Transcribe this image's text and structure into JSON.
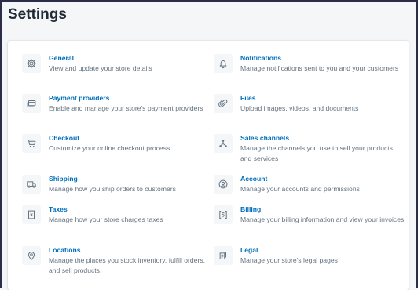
{
  "page": {
    "title": "Settings"
  },
  "settings": {
    "items": [
      {
        "icon": "gear-icon",
        "title": "General",
        "description": "View and update your store details"
      },
      {
        "icon": "bell-icon",
        "title": "Notifications",
        "description": "Manage notifications sent to you and your customers"
      },
      {
        "icon": "credit-card-icon",
        "title": "Payment providers",
        "description": "Enable and manage your store's payment providers"
      },
      {
        "icon": "paperclip-icon",
        "title": "Files",
        "description": "Upload images, videos, and documents"
      },
      {
        "icon": "cart-icon",
        "title": "Checkout",
        "description": "Customize your online checkout process"
      },
      {
        "icon": "channels-icon",
        "title": "Sales channels",
        "description": "Manage the channels you use to sell your products and services"
      },
      {
        "icon": "truck-icon",
        "title": "Shipping",
        "description": "Manage how you ship orders to customers"
      },
      {
        "icon": "account-icon",
        "title": "Account",
        "description": "Manage your accounts and permissions"
      },
      {
        "icon": "receipt-icon",
        "title": "Taxes",
        "description": "Manage how your store charges taxes"
      },
      {
        "icon": "dollar-bill-icon",
        "title": "Billing",
        "description": "Manage your billing information and view your invoices"
      },
      {
        "icon": "location-pin-icon",
        "title": "Locations",
        "description": "Manage the places you stock inventory, fulfill orders, and sell products."
      },
      {
        "icon": "legal-document-icon",
        "title": "Legal",
        "description": "Manage your store's legal pages"
      }
    ]
  }
}
